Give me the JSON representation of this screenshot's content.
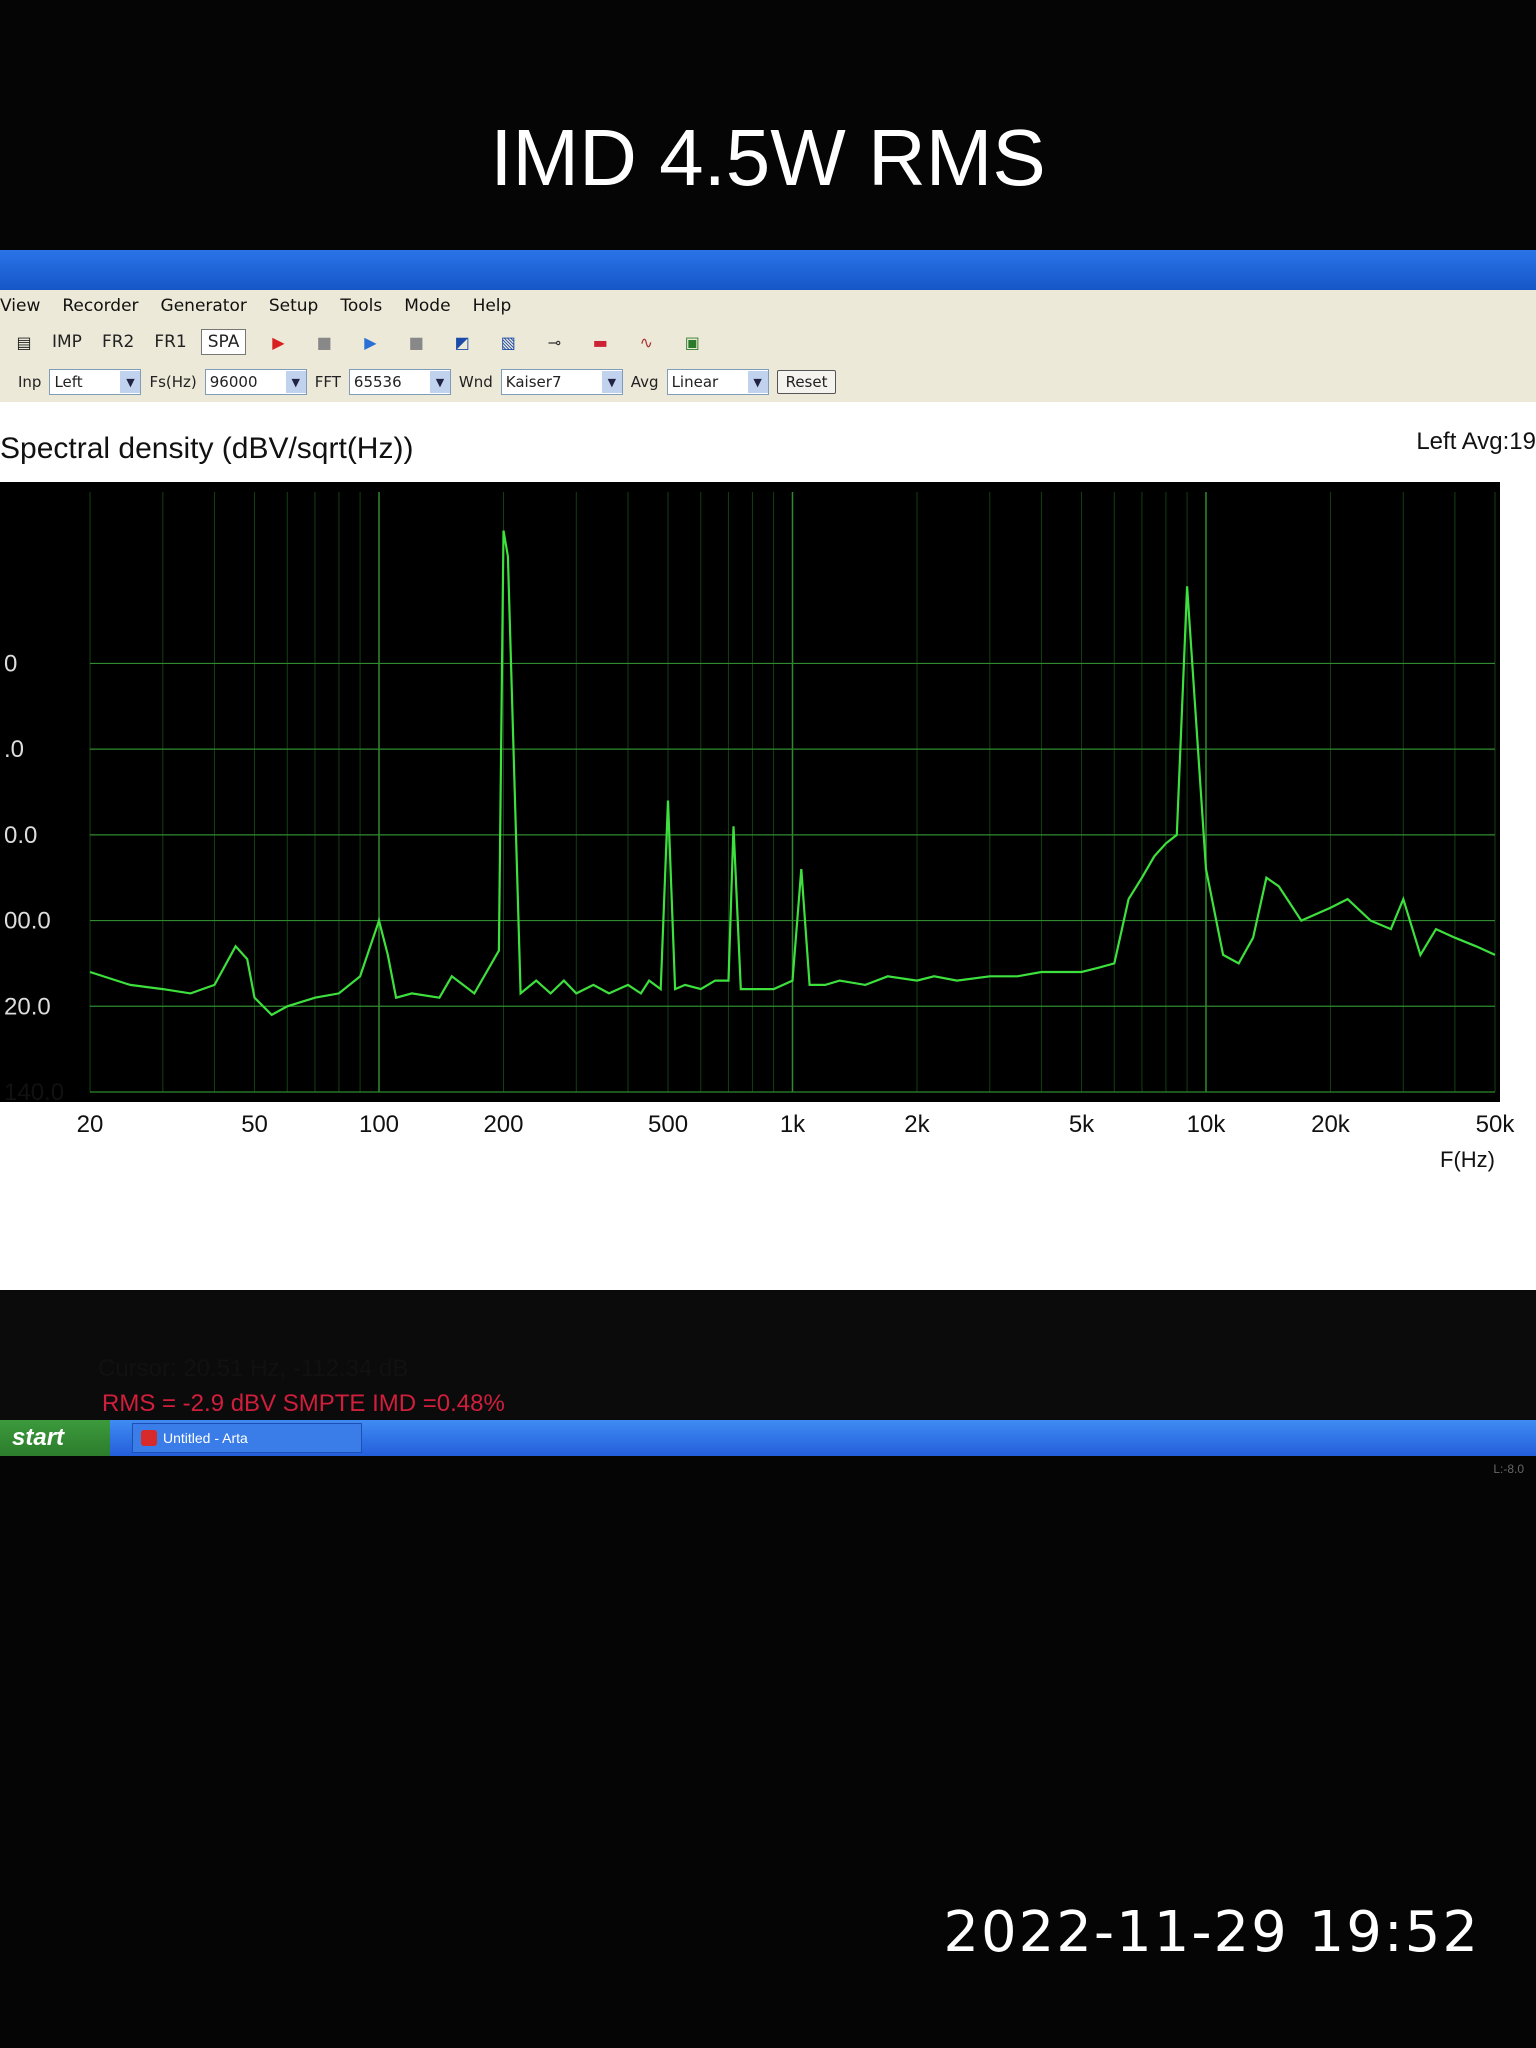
{
  "overlay": {
    "title": "IMD 4.5W RMS",
    "timestamp": "2022-11-29 19:52"
  },
  "menu": [
    "View",
    "Recorder",
    "Generator",
    "Setup",
    "Tools",
    "Mode",
    "Help"
  ],
  "toolbar": {
    "modes": [
      "IMP",
      "FR2",
      "FR1",
      "SPA"
    ],
    "active_mode": "SPA"
  },
  "controls": {
    "inp_label": "Inp",
    "inp_value": "Left",
    "fs_label": "Fs(Hz)",
    "fs_value": "96000",
    "fft_label": "FFT",
    "fft_value": "65536",
    "wnd_label": "Wnd",
    "wnd_value": "Kaiser7",
    "avg_label": "Avg",
    "avg_value": "Linear",
    "reset_label": "Reset"
  },
  "plot": {
    "title": "Spectral density (dBV/sqrt(Hz))",
    "status": "Left  Avg:19",
    "cursor": "Cursor: 20.51 Hz, -112.34 dB",
    "rms_text": "RMS =   -2.9 dBV  SMPTE IMD =0.48%",
    "version": "L:-8.0"
  },
  "taskbar": {
    "start_label": "start",
    "task_label": "Untitled - Arta"
  },
  "colors": {
    "trace": "#3de03d",
    "grid": "#2f8a2f",
    "rms_text": "#d01e3c"
  },
  "chart_data": {
    "type": "line",
    "title": "Spectral density (dBV/sqrt(Hz))",
    "xlabel": "F(Hz)",
    "ylabel": "",
    "x_scale": "log",
    "xlim": [
      20,
      50000
    ],
    "ylim": [
      -140,
      0
    ],
    "x_ticks": [
      20,
      50,
      100,
      200,
      500,
      1000,
      2000,
      5000,
      10000,
      20000,
      50000
    ],
    "x_tick_labels": [
      "20",
      "50",
      "100",
      "200",
      "500",
      "1k",
      "2k",
      "5k",
      "10k",
      "20k",
      "50k"
    ],
    "y_ticks": [
      -140,
      -120,
      -100,
      -80,
      -60,
      -40
    ],
    "y_tick_labels": [
      "140.0",
      "20.0",
      "00.0",
      "0.0",
      ".0",
      "0"
    ],
    "grid": true,
    "series": [
      {
        "x": [
          20,
          25,
          30,
          35,
          40,
          45,
          48,
          50,
          55,
          60,
          70,
          80,
          90,
          100,
          105,
          110,
          120,
          140,
          150,
          170,
          195,
          200,
          205,
          220,
          240,
          260,
          280,
          300,
          330,
          360,
          400,
          430,
          450,
          480,
          500,
          520,
          550,
          600,
          650,
          700,
          720,
          750,
          800,
          900,
          1000,
          1050,
          1100,
          1200,
          1300,
          1500,
          1700,
          2000,
          2200,
          2500,
          3000,
          3500,
          4000,
          4500,
          5000,
          5500,
          6000,
          6500,
          7000,
          7500,
          8000,
          8500,
          9000,
          10000,
          11000,
          12000,
          13000,
          14000,
          15000,
          17000,
          20000,
          22000,
          25000,
          28000,
          30000,
          33000,
          36000,
          40000,
          45000,
          50000
        ],
        "y": [
          -112,
          -115,
          -116,
          -117,
          -115,
          -106,
          -109,
          -118,
          -122,
          -120,
          -118,
          -117,
          -113,
          -100,
          -108,
          -118,
          -117,
          -118,
          -113,
          -117,
          -107,
          -9,
          -15,
          -117,
          -114,
          -117,
          -114,
          -117,
          -115,
          -117,
          -115,
          -117,
          -114,
          -116,
          -72,
          -116,
          -115,
          -116,
          -114,
          -114,
          -78,
          -116,
          -116,
          -116,
          -114,
          -88,
          -115,
          -115,
          -114,
          -115,
          -113,
          -114,
          -113,
          -114,
          -113,
          -113,
          -112,
          -112,
          -112,
          -111,
          -110,
          -95,
          -90,
          -85,
          -82,
          -80,
          -22,
          -88,
          -108,
          -110,
          -104,
          -90,
          -92,
          -100,
          -97,
          -95,
          -100,
          -102,
          -95,
          -108,
          -102,
          -104,
          -106,
          -108
        ]
      }
    ]
  }
}
